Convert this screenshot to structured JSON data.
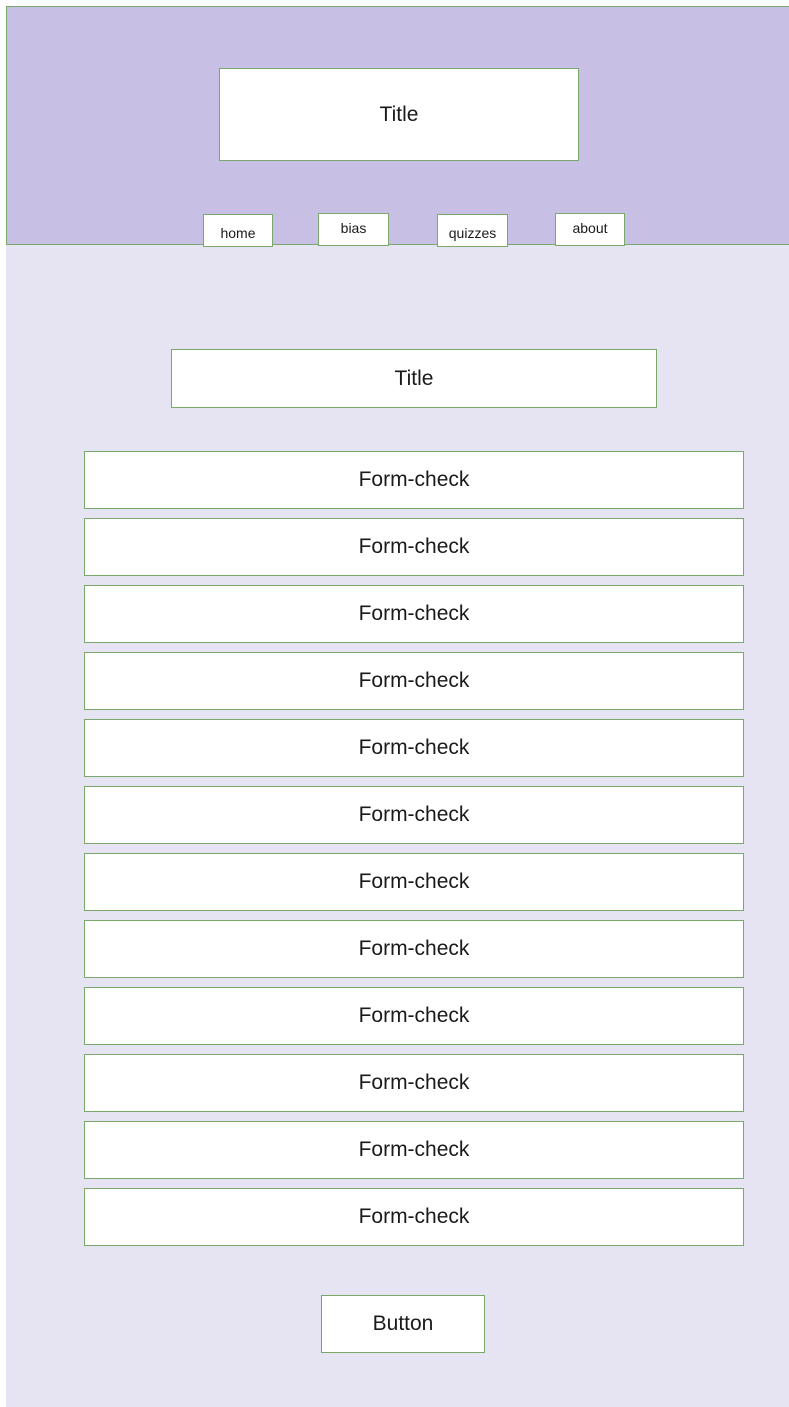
{
  "header": {
    "title": "Title",
    "nav": [
      {
        "label": "home"
      },
      {
        "label": "bias"
      },
      {
        "label": "quizzes"
      },
      {
        "label": "about"
      }
    ]
  },
  "main": {
    "title": "Title",
    "form_checks": [
      {
        "label": "Form-check"
      },
      {
        "label": "Form-check"
      },
      {
        "label": "Form-check"
      },
      {
        "label": "Form-check"
      },
      {
        "label": "Form-check"
      },
      {
        "label": "Form-check"
      },
      {
        "label": "Form-check"
      },
      {
        "label": "Form-check"
      },
      {
        "label": "Form-check"
      },
      {
        "label": "Form-check"
      },
      {
        "label": "Form-check"
      },
      {
        "label": "Form-check"
      }
    ],
    "button_label": "Button"
  },
  "colors": {
    "header_background": "#c8c0e4",
    "page_background": "#e6e4f2",
    "box_border": "#7aa86a",
    "box_fill": "#ffffff"
  }
}
